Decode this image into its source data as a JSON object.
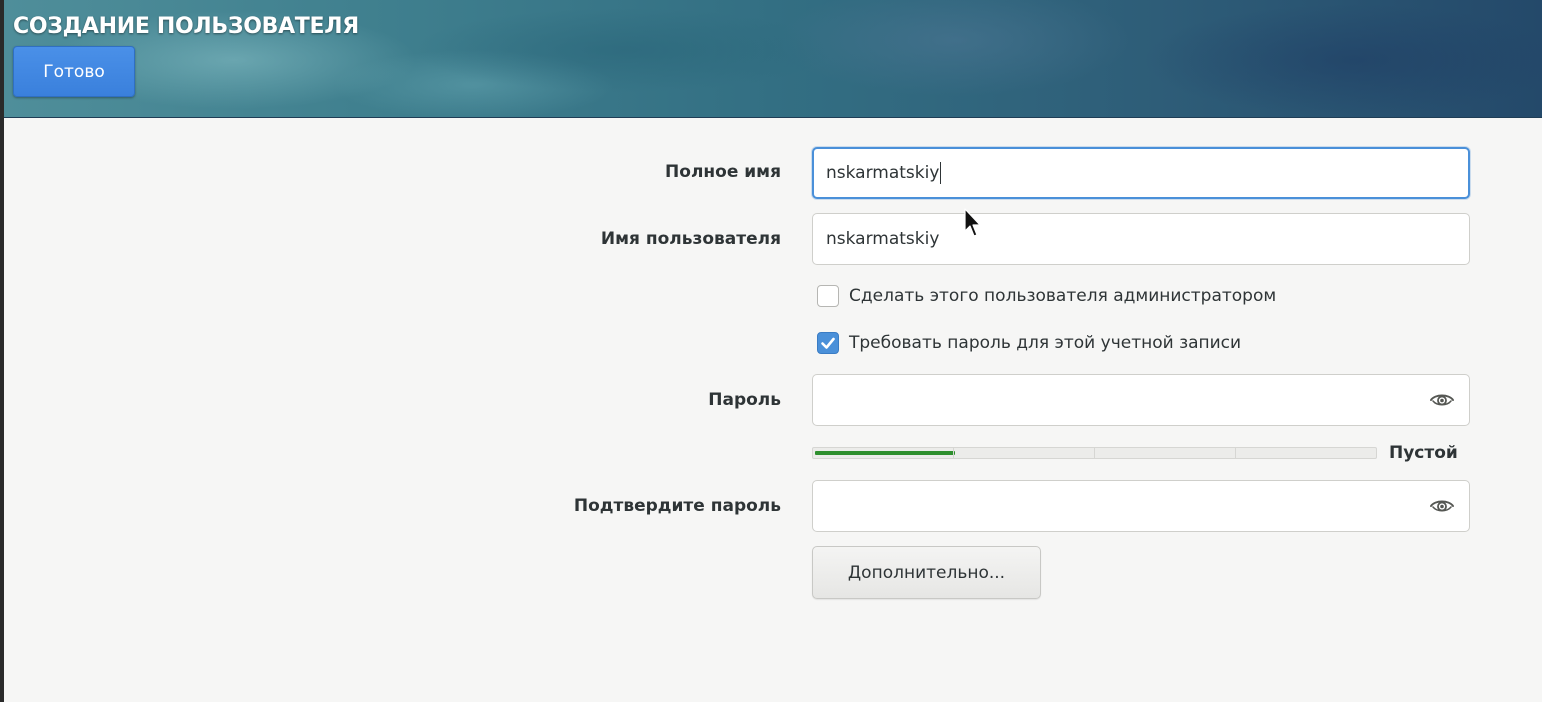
{
  "header": {
    "title": "СОЗДАНИЕ ПОЛЬЗОВАТЕЛЯ",
    "done_label": "Готово"
  },
  "form": {
    "full_name": {
      "label": "Полное имя",
      "value": "nskarmatskiy"
    },
    "username": {
      "label": "Имя пользователя",
      "value": "nskarmatskiy"
    },
    "make_admin": {
      "label": "Сделать этого пользователя администратором",
      "checked": false
    },
    "require_password": {
      "label": "Требовать пароль для этой учетной записи",
      "checked": true
    },
    "password": {
      "label": "Пароль",
      "value": ""
    },
    "password_strength": {
      "text": "Пустой",
      "level_fraction": 0.25,
      "segments": 4
    },
    "confirm_password": {
      "label": "Подтвердите пароль",
      "value": ""
    },
    "advanced_label": "Дополнительно..."
  },
  "colors": {
    "accent": "#4a90d9",
    "strength_fill": "#2e8f2e",
    "done_button": "#3a80dc"
  },
  "icons": {
    "password_reveal": "eye-icon",
    "confirm_reveal": "eye-icon",
    "checkbox_check": "checkmark-icon",
    "pointer": "mouse-pointer-icon"
  }
}
